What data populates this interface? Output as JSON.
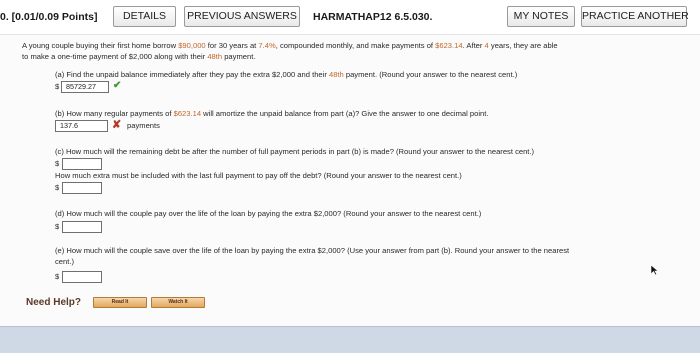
{
  "header": {
    "question_points": "0. [0.01/0.09 Points]",
    "details_label": "DETAILS",
    "previous_answers_label": "PREVIOUS ANSWERS",
    "source_ref": "HARMATHAP12 6.5.030.",
    "my_notes_label": "MY NOTES",
    "practice_another_label": "PRACTICE ANOTHER"
  },
  "problem": {
    "line1_prefix": "A young couple buying their first home borrow ",
    "principal": "$90,000",
    "line1_mid1": " for 30 years at ",
    "rate": "7.4%",
    "line1_mid2": ", compounded monthly, and make payments of ",
    "payment": "$623.14",
    "line1_mid3": ". After ",
    "years": "4",
    "line1_suffix": " years, they are able",
    "line2_prefix": "to make a one-time payment of $2,000 along with their ",
    "payment_number": "48th",
    "line2_suffix": " payment."
  },
  "part_a": {
    "prompt_prefix": "(a) Find the unpaid balance immediately after they pay the extra $2,000 and their ",
    "payment_number": "48th",
    "prompt_suffix": " payment. (Round your answer to the nearest cent.)",
    "currency": "$",
    "answer": "85729.27"
  },
  "part_b": {
    "prompt_prefix": "(b) How many regular payments of ",
    "payment": "$623.14",
    "prompt_suffix": " will amortize the unpaid balance from part (a)? Give the answer to one decimal point.",
    "answer": "137.6",
    "unit": "payments"
  },
  "part_c": {
    "prompt1": "(c) How much will the remaining debt be after the number of full payment periods in part (b) is made? (Round your answer to the nearest cent.)",
    "currency1": "$",
    "prompt2": "How much extra must be included with the last full payment to pay off the debt? (Round your answer to the nearest cent.)",
    "currency2": "$"
  },
  "part_d": {
    "prompt": "(d) How much will the couple pay over the life of the loan by paying the extra $2,000? (Round your answer to the nearest cent.)",
    "currency": "$"
  },
  "part_e": {
    "prompt1": "(e) How much will the couple save over the life of the loan by paying the extra $2,000? (Use your answer from part (b). Round your answer to the nearest",
    "prompt2": "cent.)",
    "currency": "$"
  },
  "help": {
    "label": "Need Help?",
    "read_it_label": "Read It",
    "watch_it_label": "Watch It"
  },
  "colors": {
    "highlight": "#c2672b",
    "check": "#3e9a2a",
    "wrong": "#b23a2a"
  }
}
